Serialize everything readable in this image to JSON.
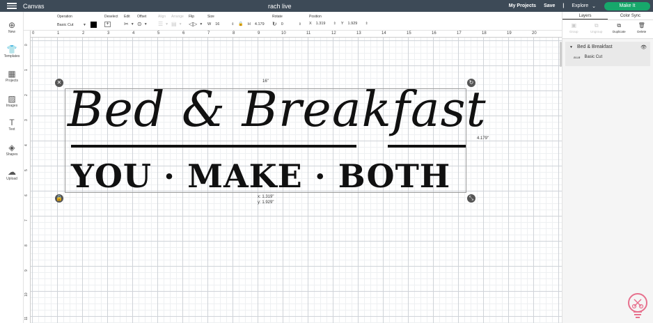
{
  "header": {
    "app_title": "Canvas",
    "doc_title": "rach live",
    "my_projects": "My Projects",
    "save": "Save",
    "separator": "|",
    "explore": "Explore",
    "make_it": "Make It"
  },
  "toolbar": {
    "operation": {
      "label": "Operation",
      "value": "Basic Cut"
    },
    "deselect": {
      "label": "Deselect"
    },
    "edit": {
      "label": "Edit"
    },
    "offset": {
      "label": "Offset"
    },
    "align": {
      "label": "Align"
    },
    "arrange": {
      "label": "Arrange"
    },
    "flip": {
      "label": "Flip"
    },
    "size": {
      "label": "Size",
      "w_label": "W",
      "w_value": "16",
      "h_label": "H",
      "h_value": "4.179"
    },
    "rotate": {
      "label": "Rotate",
      "value": "0"
    },
    "position": {
      "label": "Position",
      "x_label": "X",
      "x_value": "1.319",
      "y_label": "Y",
      "y_value": "1.929"
    }
  },
  "leftbar": [
    {
      "label": "New",
      "icon": "plus-circle-icon"
    },
    {
      "label": "Templates",
      "icon": "shirt-icon"
    },
    {
      "label": "Projects",
      "icon": "projects-icon"
    },
    {
      "label": "Images",
      "icon": "image-icon"
    },
    {
      "label": "Text",
      "icon": "text-icon"
    },
    {
      "label": "Shapes",
      "icon": "shapes-icon"
    },
    {
      "label": "Upload",
      "icon": "upload-icon"
    }
  ],
  "canvas": {
    "ruler_top": [
      "0",
      "1",
      "2",
      "3",
      "4",
      "5",
      "6",
      "7",
      "8",
      "9",
      "10",
      "11",
      "12",
      "13",
      "14",
      "15",
      "16",
      "17",
      "18",
      "19",
      "20"
    ],
    "ruler_left": [
      "0",
      "1",
      "2",
      "3",
      "4",
      "5",
      "6",
      "7",
      "8",
      "9",
      "10",
      "11"
    ],
    "width_label": "16\"",
    "height_label": "4.179\"",
    "pos_x": "x: 1.319\"",
    "pos_y": "y: 1.929\"",
    "design_line1": "Bed & Breakfast",
    "design_line2": "YOU · MAKE · BOTH"
  },
  "rightpanel": {
    "tabs": [
      "Layers",
      "Color Sync"
    ],
    "actions": [
      {
        "label": "Group",
        "enabled": false
      },
      {
        "label": "Ungroup",
        "enabled": false
      },
      {
        "label": "Duplicate",
        "enabled": true
      },
      {
        "label": "Delete",
        "enabled": true
      }
    ],
    "layer_group_name": "Bed & Breakfast",
    "layer_name": "Basic Cut"
  },
  "colors": {
    "topbar": "#3d4a57",
    "make_it": "#17a86b",
    "design": "#111111"
  }
}
